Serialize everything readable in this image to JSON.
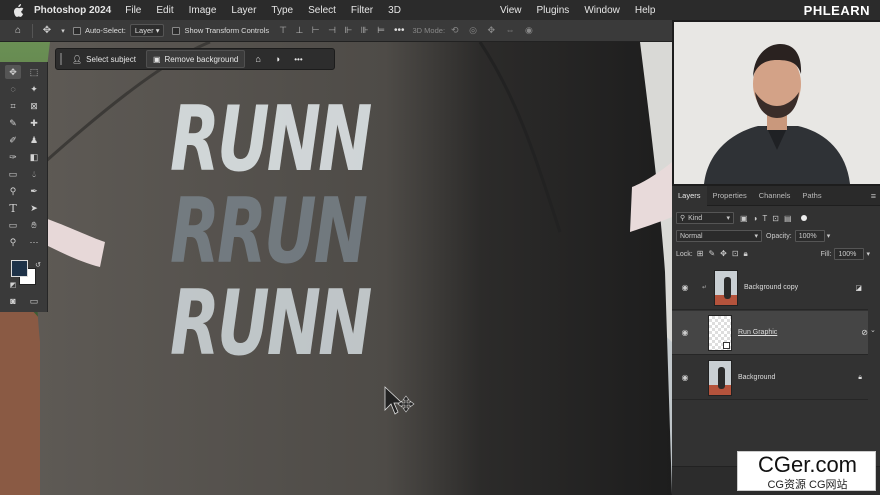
{
  "menubar": {
    "app_name": "Photoshop 2024",
    "items": [
      "File",
      "Edit",
      "Image",
      "Layer",
      "Type",
      "Select",
      "Filter",
      "3D"
    ],
    "right_items": [
      "View",
      "Plugins",
      "Window",
      "Help"
    ],
    "brand": "PHLEARN"
  },
  "options_bar": {
    "auto_select_label": "Auto-Select:",
    "auto_select_value": "Layer",
    "show_transform_label": "Show Transform Controls",
    "mode_3d_label": "3D Mode:"
  },
  "context_bar": {
    "select_subject": "Select subject",
    "remove_background": "Remove background",
    "more": "•••"
  },
  "canvas": {
    "graphic_words": [
      "RUNN",
      "RRUN",
      "RUNN"
    ]
  },
  "panel": {
    "tabs": [
      "Layers",
      "Properties",
      "Channels",
      "Paths"
    ],
    "kind_label": "Kind",
    "blend_mode": "Normal",
    "opacity_label": "Opacity:",
    "opacity_value": "100%",
    "lock_label": "Lock:",
    "fill_label": "Fill:",
    "fill_value": "100%",
    "layers": [
      {
        "name": "Background copy"
      },
      {
        "name": "Run Graphic"
      },
      {
        "name": "Background"
      }
    ]
  },
  "watermark": {
    "line1": "CGer.com",
    "line2": "CG资源 CG网站"
  },
  "colors": {
    "foreground": "#1e3248",
    "background": "#ffffff"
  }
}
